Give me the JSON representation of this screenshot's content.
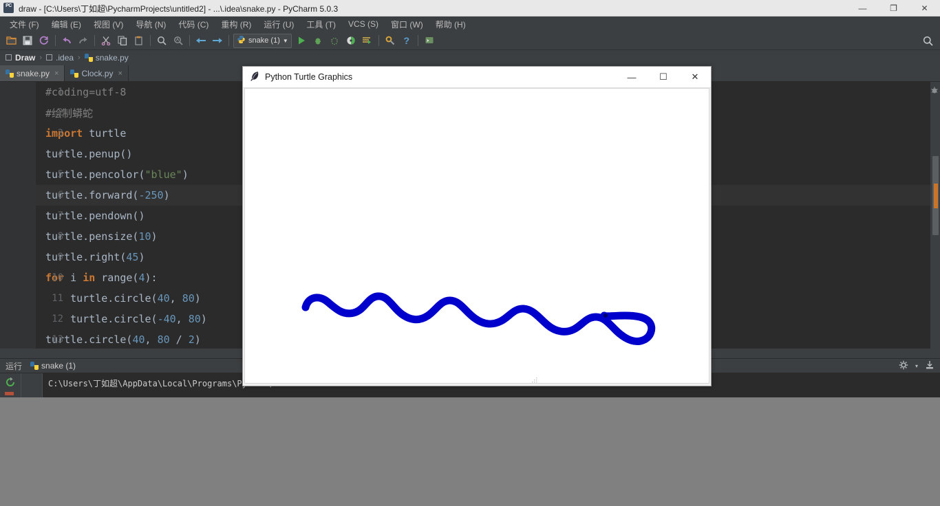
{
  "window": {
    "title": "draw - [C:\\Users\\丁如超\\PycharmProjects\\untitled2] - ...\\.idea\\snake.py - PyCharm 5.0.3",
    "app_badge": "PC",
    "minimize": "—",
    "maximize": "❐",
    "close": "✕"
  },
  "menubar": {
    "items": [
      {
        "label": "文件 (F)"
      },
      {
        "label": "编辑 (E)"
      },
      {
        "label": "视图 (V)"
      },
      {
        "label": "导航 (N)"
      },
      {
        "label": "代码 (C)"
      },
      {
        "label": "重构 (R)"
      },
      {
        "label": "运行 (U)"
      },
      {
        "label": "工具 (T)"
      },
      {
        "label": "VCS (S)"
      },
      {
        "label": "窗口 (W)"
      },
      {
        "label": "帮助 (H)"
      }
    ]
  },
  "toolbar": {
    "run_config": "snake (1)",
    "dropdown_arrow": "▼",
    "help_glyph": "?"
  },
  "breadcrumb": {
    "items": [
      {
        "label": "Draw",
        "icon": "module-icon"
      },
      {
        "label": ".idea",
        "icon": "folder-icon"
      },
      {
        "label": "snake.py",
        "icon": "python-file-icon"
      }
    ],
    "separator": "›"
  },
  "editor_tabs": [
    {
      "label": "snake.py",
      "active": true,
      "close": "×"
    },
    {
      "label": "Clock.py",
      "active": false,
      "close": "×"
    }
  ],
  "code": {
    "lines": [
      {
        "n": "1",
        "current": false,
        "tokens": [
          {
            "t": "#coding=utf-8",
            "c": "cmt"
          }
        ]
      },
      {
        "n": "2",
        "current": false,
        "tokens": [
          {
            "t": "#绘制蟒蛇",
            "c": "cmt"
          }
        ]
      },
      {
        "n": "3",
        "current": false,
        "tokens": [
          {
            "t": "import",
            "c": "kw"
          },
          {
            "t": " turtle",
            "c": "fn"
          }
        ]
      },
      {
        "n": "4",
        "current": false,
        "tokens": [
          {
            "t": "turtle.penup()",
            "c": "fn"
          }
        ]
      },
      {
        "n": "5",
        "current": false,
        "tokens": [
          {
            "t": "turtle.pencolor(",
            "c": "fn"
          },
          {
            "t": "\"blue\"",
            "c": "str"
          },
          {
            "t": ")",
            "c": "fn"
          }
        ]
      },
      {
        "n": "6",
        "current": true,
        "tokens": [
          {
            "t": "turtle.forward(",
            "c": "fn"
          },
          {
            "t": "-250",
            "c": "num"
          },
          {
            "t": ")",
            "c": "fn"
          }
        ]
      },
      {
        "n": "7",
        "current": false,
        "tokens": [
          {
            "t": "turtle.pendown()",
            "c": "fn"
          }
        ]
      },
      {
        "n": "8",
        "current": false,
        "tokens": [
          {
            "t": "turtle.pensize(",
            "c": "fn"
          },
          {
            "t": "10",
            "c": "num"
          },
          {
            "t": ")",
            "c": "fn"
          }
        ]
      },
      {
        "n": "9",
        "current": false,
        "tokens": [
          {
            "t": "turtle.right(",
            "c": "fn"
          },
          {
            "t": "45",
            "c": "num"
          },
          {
            "t": ")",
            "c": "fn"
          }
        ]
      },
      {
        "n": "10",
        "current": false,
        "tokens": [
          {
            "t": "for",
            "c": "kw"
          },
          {
            "t": " i ",
            "c": "fn"
          },
          {
            "t": "in",
            "c": "kw"
          },
          {
            "t": " range(",
            "c": "fn"
          },
          {
            "t": "4",
            "c": "num"
          },
          {
            "t": "):",
            "c": "fn"
          }
        ]
      },
      {
        "n": "11",
        "current": false,
        "tokens": [
          {
            "t": "    turtle.circle(",
            "c": "fn"
          },
          {
            "t": "40",
            "c": "num"
          },
          {
            "t": ", ",
            "c": "fn"
          },
          {
            "t": "80",
            "c": "num"
          },
          {
            "t": ")",
            "c": "fn"
          }
        ]
      },
      {
        "n": "12",
        "current": false,
        "tokens": [
          {
            "t": "    turtle.circle(",
            "c": "fn"
          },
          {
            "t": "-40",
            "c": "num"
          },
          {
            "t": ", ",
            "c": "fn"
          },
          {
            "t": "80",
            "c": "num"
          },
          {
            "t": ")",
            "c": "fn"
          }
        ]
      },
      {
        "n": "13",
        "current": false,
        "tokens": [
          {
            "t": "turtle.circle(",
            "c": "fn"
          },
          {
            "t": "40",
            "c": "num"
          },
          {
            "t": ", ",
            "c": "fn"
          },
          {
            "t": "80",
            "c": "num"
          },
          {
            "t": " / ",
            "c": "fn"
          },
          {
            "t": "2",
            "c": "num"
          },
          {
            "t": ")",
            "c": "fn"
          }
        ]
      }
    ]
  },
  "run_panel": {
    "label": "运行",
    "tab_label": "snake (1)",
    "console_output": "C:\\Users\\丁如超\\AppData\\Local\\Programs\\Python\\"
  },
  "turtle_window": {
    "title": "Python Turtle Graphics",
    "icon": "feather-icon",
    "minimize": "—",
    "maximize": "☐",
    "close": "✕",
    "drawing": {
      "stroke_color": "#0000CC",
      "stroke_width": 11,
      "background": "#ffffff"
    }
  },
  "colors": {
    "ide_bg": "#3c3f41",
    "editor_bg": "#2b2b2b",
    "gutter_bg": "#313335",
    "desktop": "#808080",
    "accent_orange": "#cc7832",
    "keyword": "#cc7832",
    "string": "#6a8759",
    "number": "#6897bb",
    "comment": "#808080",
    "text": "#a9b7c6",
    "snake_blue": "#0000CC"
  }
}
